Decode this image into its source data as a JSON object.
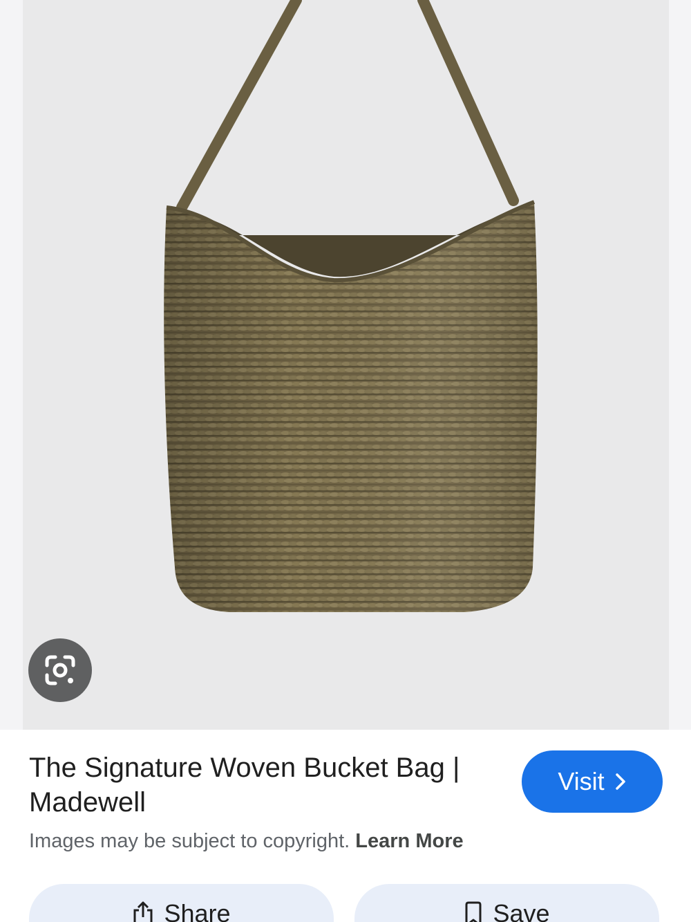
{
  "image": {
    "alt": "The Signature Woven Bucket Bag | Madewell",
    "lens_icon": "google-lens-icon"
  },
  "result": {
    "title": "The Signature Woven Bucket Bag | Madewell",
    "visit_label": "Visit",
    "visit_icon": "chevron-right-icon"
  },
  "copyright": {
    "text": "Images may be subject to copyright.",
    "learn_more": "Learn More"
  },
  "actions": {
    "share_label": "Share",
    "share_icon": "share-icon",
    "save_label": "Save",
    "save_icon": "bookmark-icon"
  },
  "colors": {
    "accent": "#1a73e8",
    "action_bg": "#e8eef9",
    "lens_bg": "#5f6061"
  }
}
